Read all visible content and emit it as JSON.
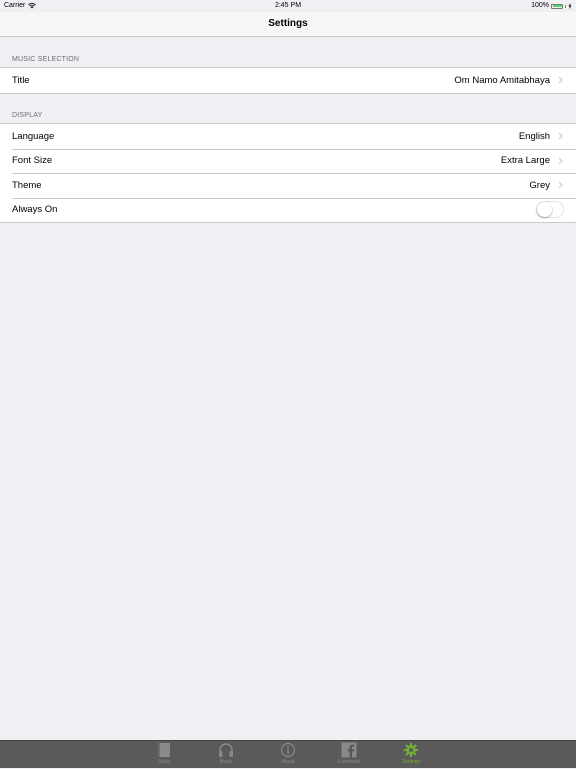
{
  "status_bar": {
    "carrier": "Carrier",
    "time": "2:45 PM",
    "battery": "100%"
  },
  "nav": {
    "title": "Settings"
  },
  "sections": {
    "music": {
      "header": "MUSIC SELECTION",
      "rows": [
        {
          "label": "Title",
          "value": "Om Namo Amitabhaya"
        }
      ]
    },
    "display": {
      "header": "DISPLAY",
      "rows": [
        {
          "label": "Language",
          "value": "English"
        },
        {
          "label": "Font Size",
          "value": "Extra Large"
        },
        {
          "label": "Theme",
          "value": "Grey"
        },
        {
          "label": "Always On",
          "toggle": false
        }
      ]
    }
  },
  "tabs": [
    {
      "label": "Sutra",
      "icon": "book-icon"
    },
    {
      "label": "Music",
      "icon": "headphones-icon"
    },
    {
      "label": "About",
      "icon": "info-icon"
    },
    {
      "label": "Facebook",
      "icon": "facebook-icon"
    },
    {
      "label": "Settings",
      "icon": "gear-icon",
      "active": true
    }
  ],
  "colors": {
    "accent": "#6fae3c",
    "tabbar_bg": "#5a5a5a",
    "background": "#efeff4",
    "battery": "#4cd964"
  }
}
